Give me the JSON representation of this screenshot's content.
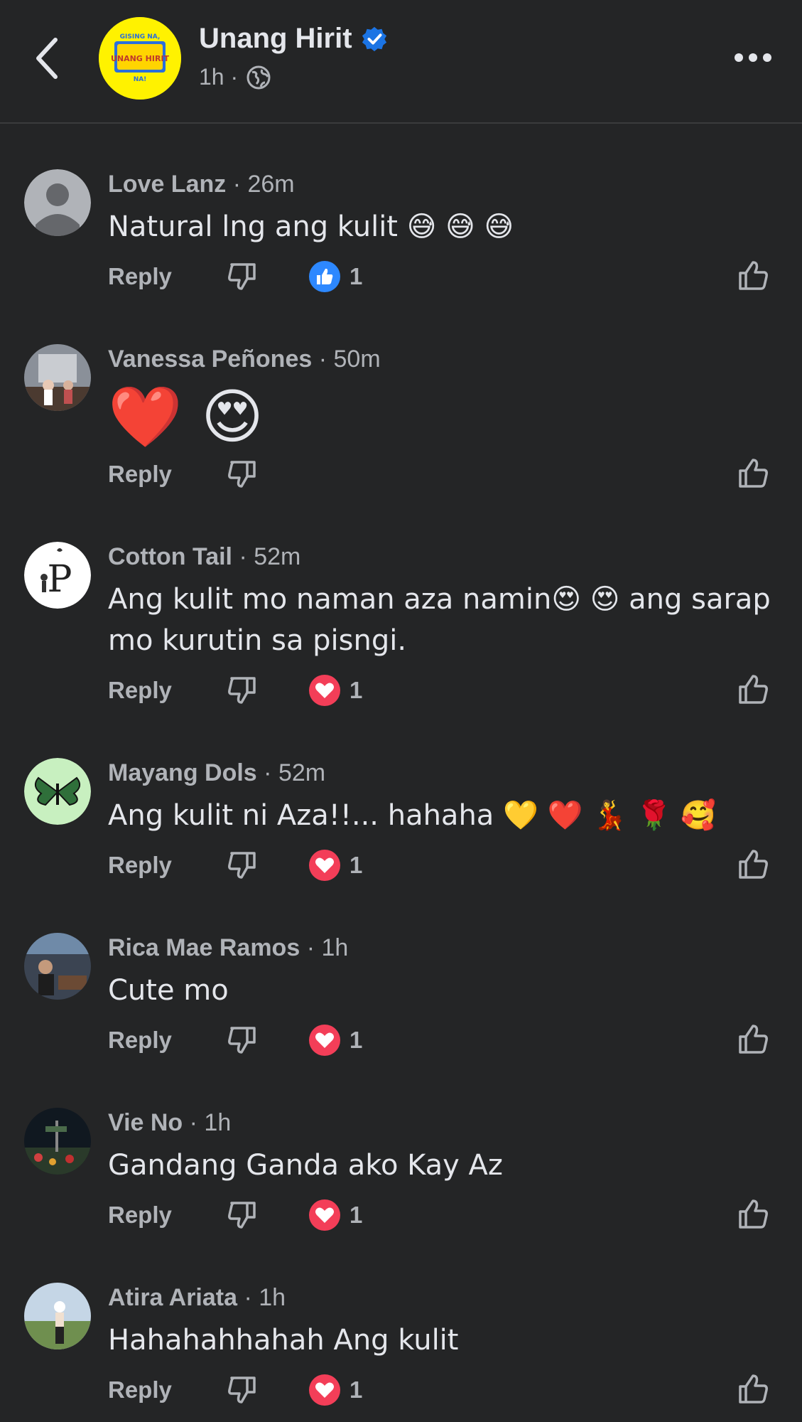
{
  "header": {
    "page_name": "Unang Hirit",
    "time": "1h ·",
    "avatar_text_top": "GISING NA,",
    "avatar_text_main": "UNANG HIRIT",
    "avatar_text_bottom": "NA!"
  },
  "colors": {
    "background": "#242526",
    "verified": "#1b74e4",
    "like_blue": "#2d88ff",
    "love_red": "#f33e58"
  },
  "comments": [
    {
      "author": "Love Lanz",
      "time": "· 26m",
      "text": "Natural lng ang kulit 😅 😅 😅",
      "reply_label": "Reply",
      "reaction": "like",
      "reaction_count": "1"
    },
    {
      "author": "Vanessa Peñones",
      "time": "· 50m",
      "text": "❤️ 😍",
      "reply_label": "Reply",
      "reaction": "",
      "reaction_count": ""
    },
    {
      "author": "Cotton Tail",
      "time": "· 52m",
      "text": "Ang kulit mo naman aza namin😍 😍  ang sarap mo  kurutin sa pisngi.",
      "reply_label": "Reply",
      "reaction": "love",
      "reaction_count": "1"
    },
    {
      "author": "Mayang Dols",
      "time": "· 52m",
      "text": "Ang kulit ni Aza!!... hahaha 💛 ❤️ 💃 🌹 🥰",
      "reply_label": "Reply",
      "reaction": "love",
      "reaction_count": "1"
    },
    {
      "author": "Rica Mae Ramos",
      "time": "· 1h",
      "text": "Cute mo",
      "reply_label": "Reply",
      "reaction": "love",
      "reaction_count": "1"
    },
    {
      "author": "Vie No",
      "time": "· 1h",
      "text": "Gandang Ganda ako Kay Az",
      "reply_label": "Reply",
      "reaction": "love",
      "reaction_count": "1"
    },
    {
      "author": "Atira Ariata",
      "time": "· 1h",
      "text": "Hahahahhahah Ang kulit",
      "reply_label": "Reply",
      "reaction": "love",
      "reaction_count": "1"
    }
  ]
}
